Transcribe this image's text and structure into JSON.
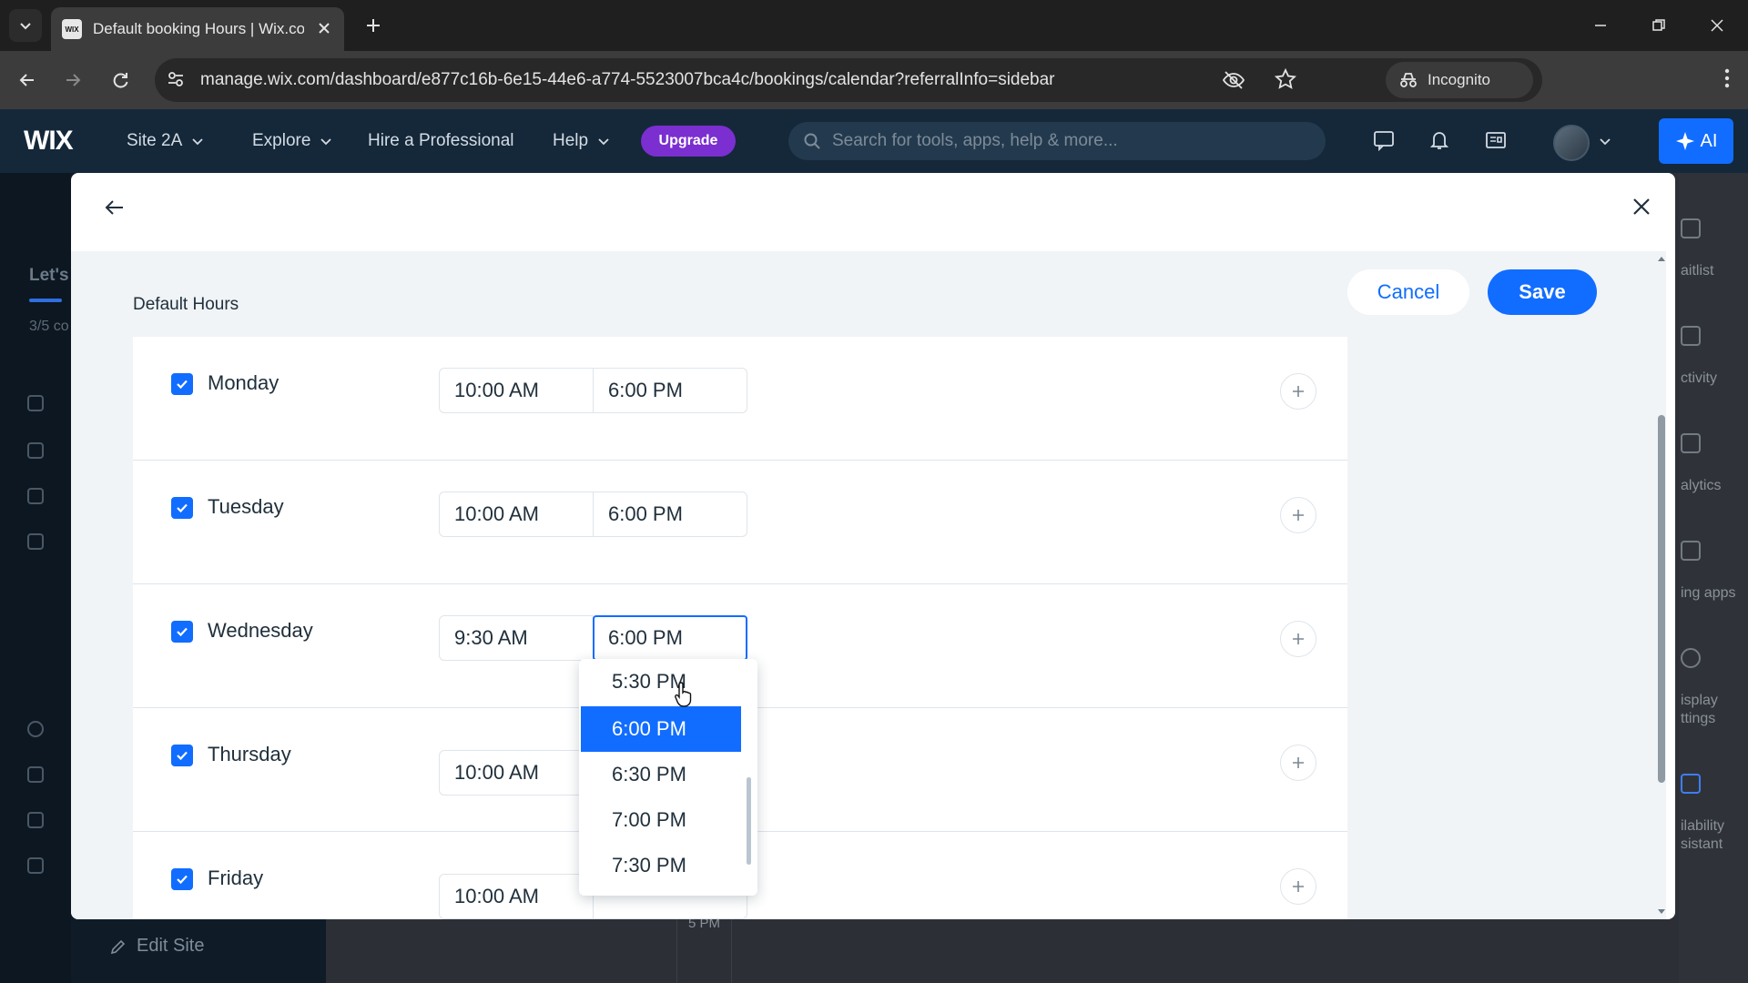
{
  "browser": {
    "tab_title": "Default booking Hours | Wix.com",
    "favicon_text": "WIX",
    "url": "manage.wix.com/dashboard/e877c16b-6e15-44e6-a774-5523007bca4c/bookings/calendar?referralInfo=sidebar",
    "incognito_label": "Incognito"
  },
  "wix_topbar": {
    "logo": "WIX",
    "site_name": "Site 2A",
    "explore": "Explore",
    "hire": "Hire a Professional",
    "help": "Help",
    "upgrade": "Upgrade",
    "search_placeholder": "Search for tools, apps, help & more...",
    "ai_label": "AI"
  },
  "sidebar": {
    "heading_partial": "Let's",
    "progress_partial": "3/5 co",
    "edit_site": "Edit Site"
  },
  "background": {
    "time_label": "5 PM"
  },
  "right_rail": {
    "items": [
      "aitlist",
      "ctivity",
      "alytics",
      "ing apps",
      "isplay\nttings",
      "ilability\nsistant"
    ]
  },
  "modal": {
    "title": "Default Hours",
    "cancel": "Cancel",
    "save": "Save",
    "days": [
      {
        "name": "Monday",
        "checked": true,
        "start": "10:00 AM",
        "end": "6:00 PM"
      },
      {
        "name": "Tuesday",
        "checked": true,
        "start": "10:00 AM",
        "end": "6:00 PM"
      },
      {
        "name": "Wednesday",
        "checked": true,
        "start": "9:30 AM",
        "end": "6:00 PM"
      },
      {
        "name": "Thursday",
        "checked": true,
        "start": "10:00 AM",
        "end": ""
      },
      {
        "name": "Friday",
        "checked": true,
        "start": "10:00 AM",
        "end": ""
      }
    ],
    "dropdown": {
      "options": [
        "5:30 PM",
        "6:00 PM",
        "6:30 PM",
        "7:00 PM",
        "7:30 PM"
      ],
      "selected": "6:00 PM"
    }
  },
  "colors": {
    "accent": "#116dff",
    "upgrade": "#7b2fd0",
    "topbar": "#14283a"
  }
}
